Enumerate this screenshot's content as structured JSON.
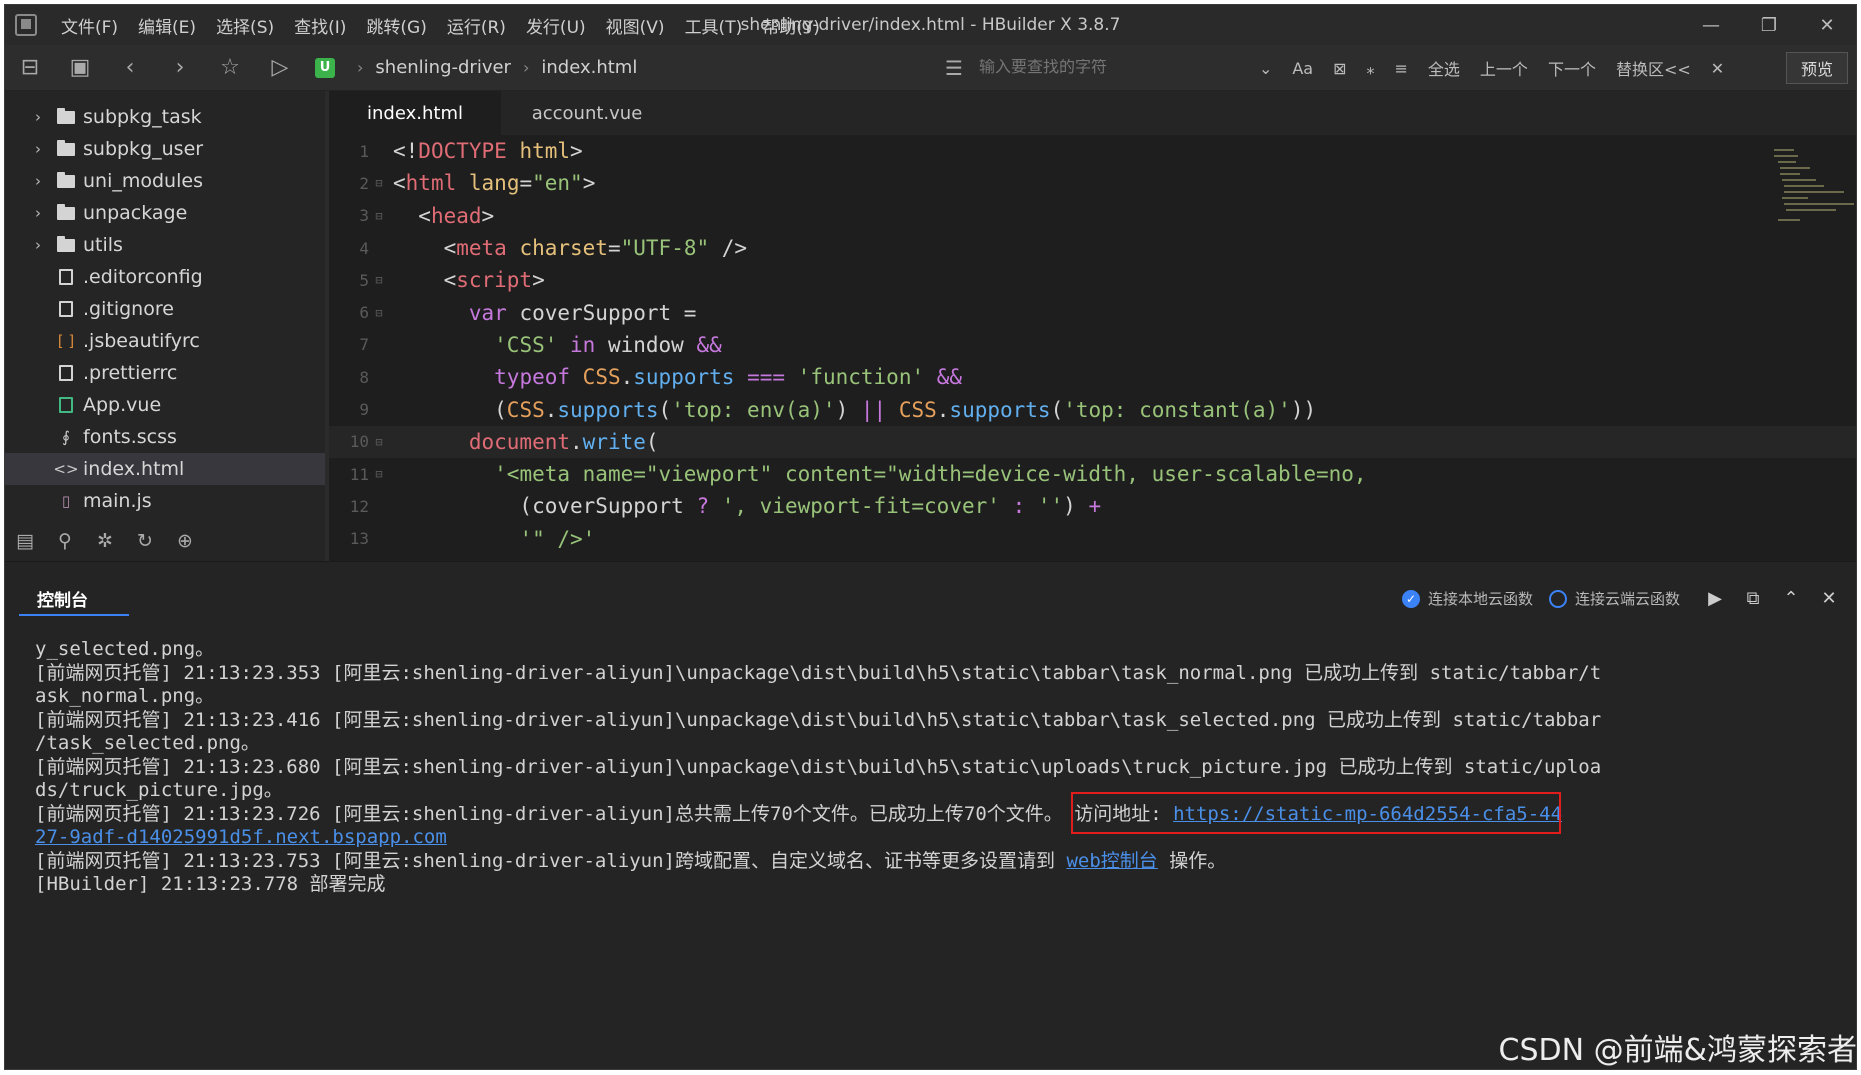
{
  "menu": [
    "文件(F)",
    "编辑(E)",
    "选择(S)",
    "查找(I)",
    "跳转(G)",
    "运行(R)",
    "发行(U)",
    "视图(V)",
    "工具(T)",
    "帮助(Y)"
  ],
  "window_title": "shenling-driver/index.html - HBuilder X 3.8.7",
  "breadcrumb": {
    "project": "shenling-driver",
    "file": "index.html"
  },
  "find": {
    "placeholder": "输入要查找的字符",
    "aa": "Aa",
    "select_all": "全选",
    "prev": "上一个",
    "next": "下一个",
    "replace": "替换区<<"
  },
  "preview_label": "预览",
  "sidebar": {
    "items": [
      {
        "label": "subpkg_task",
        "type": "folder"
      },
      {
        "label": "subpkg_user",
        "type": "folder"
      },
      {
        "label": "uni_modules",
        "type": "folder"
      },
      {
        "label": "unpackage",
        "type": "folder"
      },
      {
        "label": "utils",
        "type": "folder"
      },
      {
        "label": ".editorconfig",
        "type": "file"
      },
      {
        "label": ".gitignore",
        "type": "file"
      },
      {
        "label": ".jsbeautifyrc",
        "type": "json"
      },
      {
        "label": ".prettierrc",
        "type": "file"
      },
      {
        "label": "App.vue",
        "type": "vue"
      },
      {
        "label": "fonts.scss",
        "type": "style"
      },
      {
        "label": "index.html",
        "type": "html",
        "active": true
      },
      {
        "label": "main.js",
        "type": "js"
      }
    ]
  },
  "tabs": [
    "index.html",
    "account.vue"
  ],
  "code": {
    "line_numbers": [
      "1",
      "2",
      "3",
      "4",
      "5",
      "6",
      "7",
      "8",
      "9",
      "10",
      "11",
      "12",
      "13"
    ]
  },
  "console": {
    "tab_label": "控制台",
    "opt_local": "连接本地云函数",
    "opt_cloud": "连接云端云函数",
    "lines": [
      "y_selected.png。",
      "[前端网页托管] 21:13:23.353 [阿里云:shenling-driver-aliyun]\\unpackage\\dist\\build\\h5\\static\\tabbar\\task_normal.png 已成功上传到 static/tabbar/t",
      "ask_normal.png。",
      "[前端网页托管] 21:13:23.416 [阿里云:shenling-driver-aliyun]\\unpackage\\dist\\build\\h5\\static\\tabbar\\task_selected.png 已成功上传到 static/tabbar",
      "/task_selected.png。",
      "[前端网页托管] 21:13:23.680 [阿里云:shenling-driver-aliyun]\\unpackage\\dist\\build\\h5\\static\\uploads\\truck_picture.jpg 已成功上传到 static/uploa",
      "ds/truck_picture.jpg。"
    ],
    "summary_prefix": "[前端网页托管] 21:13:23.726 [阿里云:shenling-driver-aliyun]总共需上传70个文件。已成功上传70个文件。 ",
    "visit_label": "访问地址: ",
    "visit_url_1": "https://static-mp-664d2554-cfa5-44",
    "visit_url_2": "27-9adf-d14025991d5f.next.bspapp.com",
    "cross_prefix": "[前端网页托管] 21:13:23.753 [阿里云:shenling-driver-aliyun]跨域配置、自定义域名、证书等更多设置请到 ",
    "cross_link": "web控制台",
    "cross_suffix": " 操作。",
    "final_line": "[HBuilder] 21:13:23.778 部署完成"
  },
  "watermark": "CSDN @前端&鸿蒙探索者"
}
